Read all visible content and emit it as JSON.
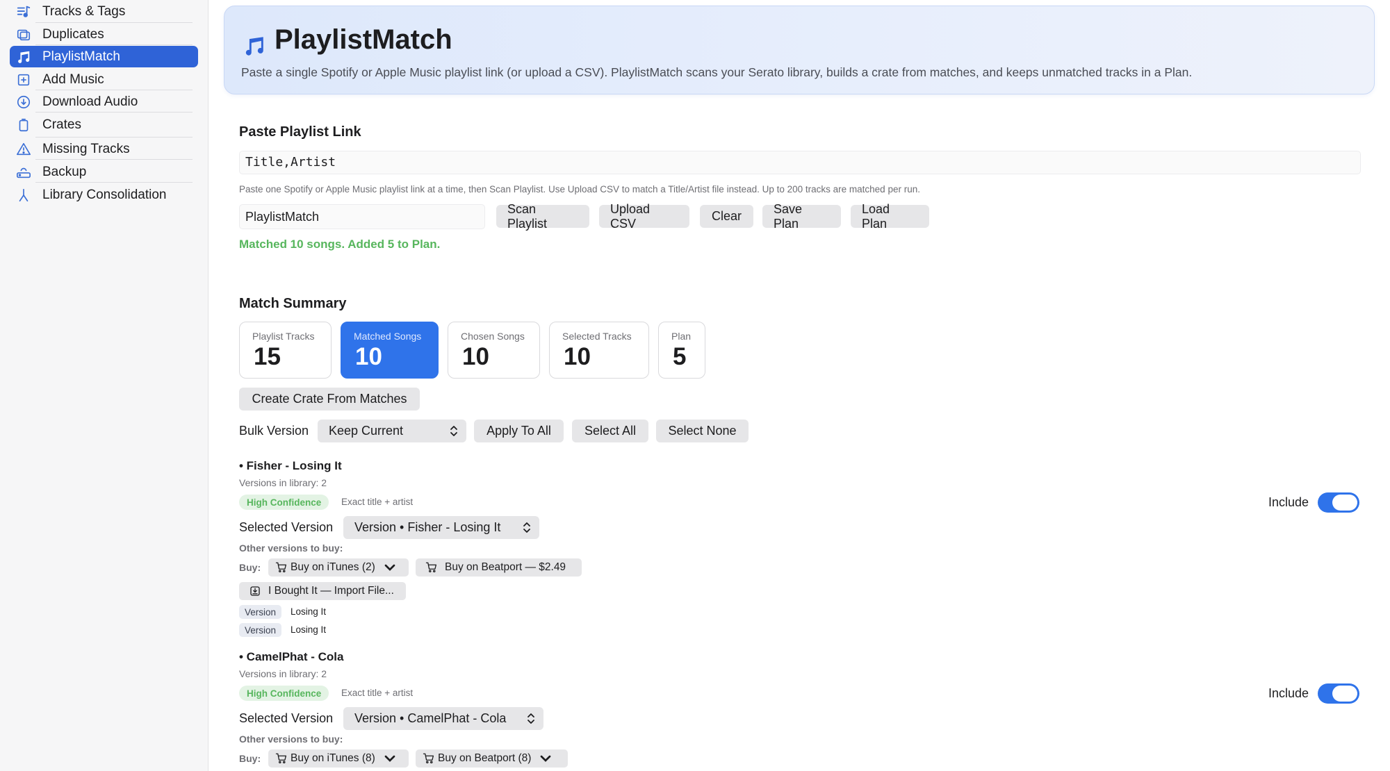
{
  "sidebar": {
    "items": [
      {
        "label": "Tracks & Tags",
        "icon": "music-list-icon"
      },
      {
        "label": "Duplicates",
        "icon": "duplicate-icon"
      },
      {
        "label": "PlaylistMatch",
        "icon": "music-notes-icon"
      },
      {
        "label": "Add Music",
        "icon": "add-music-icon"
      },
      {
        "label": "Download Audio",
        "icon": "download-icon"
      },
      {
        "label": "Crates",
        "icon": "crate-icon"
      },
      {
        "label": "Missing Tracks",
        "icon": "warning-icon"
      },
      {
        "label": "Backup",
        "icon": "backup-drive-icon"
      },
      {
        "label": "Library Consolidation",
        "icon": "merge-icon"
      }
    ],
    "active_index": 2,
    "accent": "#2f63d7"
  },
  "header": {
    "title": "PlaylistMatch",
    "subtitle": "Paste a single Spotify or Apple Music playlist link (or upload a CSV). PlaylistMatch scans your Serato library, builds a crate from matches, and keeps unmatched tracks in a Plan."
  },
  "paste": {
    "section_title": "Paste Playlist Link",
    "input_value": "Title,Artist",
    "hint": "Paste one Spotify or Apple Music playlist link at a time, then Scan Playlist. Use Upload CSV to match a Title/Artist file instead. Up to 200 tracks are matched per run.",
    "name_value": "PlaylistMatch",
    "buttons": {
      "scan": "Scan Playlist",
      "upload": "Upload CSV",
      "clear": "Clear",
      "save": "Save Plan",
      "load": "Load Plan"
    },
    "status": "Matched 10 songs. Added 5 to Plan.",
    "status_color": "#57b65d"
  },
  "summary": {
    "section_title": "Match Summary",
    "stats": [
      {
        "label": "Playlist Tracks",
        "value": "15"
      },
      {
        "label": "Matched Songs",
        "value": "10"
      },
      {
        "label": "Chosen Songs",
        "value": "10"
      },
      {
        "label": "Selected Tracks",
        "value": "10"
      },
      {
        "label": "Plan",
        "value": "5"
      }
    ],
    "active_stat": 1,
    "create_crate_label": "Create Crate From Matches",
    "bulk_label": "Bulk Version",
    "bulk_value": "Keep Current",
    "apply_all": "Apply To All",
    "select_all": "Select All",
    "select_none": "Select None"
  },
  "tracks": [
    {
      "title": "• Fisher - Losing It",
      "versions_count": "Versions in library: 2",
      "confidence": "High Confidence",
      "match_note": "Exact title + artist",
      "selected_label": "Selected Version",
      "selected_value": "Version • Fisher - Losing It",
      "other_label": "Other versions to buy:",
      "buy_label": "Buy:",
      "itunes": "Buy on iTunes (2)",
      "beatport": "Buy on Beatport — $2.49",
      "import": "I Bought It — Import File...",
      "versions": [
        {
          "tag": "Version",
          "value": "Losing It"
        },
        {
          "tag": "Version",
          "value": "Losing It"
        }
      ],
      "include_label": "Include",
      "include": true
    },
    {
      "title": "• CamelPhat - Cola",
      "versions_count": "Versions in library: 2",
      "confidence": "High Confidence",
      "match_note": "Exact title + artist",
      "selected_label": "Selected Version",
      "selected_value": "Version • CamelPhat - Cola",
      "other_label": "Other versions to buy:",
      "buy_label": "Buy:",
      "itunes": "Buy on iTunes (8)",
      "beatport": "Buy on Beatport (8)",
      "include_label": "Include",
      "include": true
    }
  ]
}
